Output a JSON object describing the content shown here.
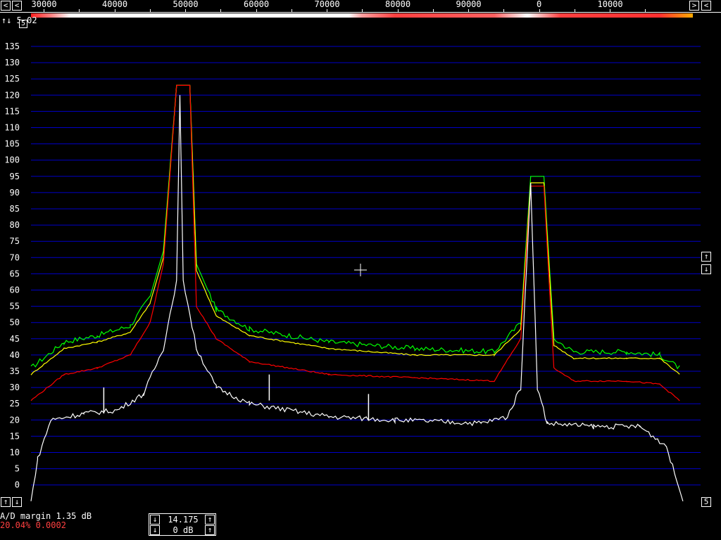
{
  "header": {
    "freq_labels": [
      "30000",
      "40000",
      "50000",
      "60000",
      "70000",
      "80000",
      "90000",
      "0",
      "10000"
    ],
    "left_arrow": "<",
    "right_arrow": ">",
    "overlay_text": "↑↓ 5.02",
    "corner_btn": "5"
  },
  "left_buttons": {
    "up": "↑",
    "down": "↓"
  },
  "right_buttons": {
    "up": "↑",
    "down": "↓",
    "corner": "5"
  },
  "status": {
    "ad_margin": "A/D margin  1.35 dB",
    "rate": "20.04% 0.0002"
  },
  "freq_box": {
    "freq": "14.175",
    "gain": "0 dB",
    "down": "↓",
    "up": "↑"
  },
  "chart_data": {
    "type": "line",
    "y_tick_labels": [
      "135",
      "130",
      "125",
      "120",
      "115",
      "110",
      "105",
      "100",
      "95",
      "90",
      "85",
      "80",
      "75",
      "70",
      "65",
      "60",
      "55",
      "50",
      "45",
      "40",
      "35",
      "30",
      "25",
      "20",
      "15",
      "10",
      "5",
      "0"
    ],
    "ylim": [
      -5,
      135
    ],
    "x_labels": [
      "30000",
      "40000",
      "50000",
      "60000",
      "70000",
      "80000",
      "90000",
      "0",
      "10000"
    ],
    "series": [
      {
        "color": "#00ff00",
        "points": [
          [
            0,
            36
          ],
          [
            0.05,
            44
          ],
          [
            0.1,
            46
          ],
          [
            0.15,
            49
          ],
          [
            0.18,
            58
          ],
          [
            0.2,
            72
          ],
          [
            0.22,
            123
          ],
          [
            0.24,
            123
          ],
          [
            0.25,
            68
          ],
          [
            0.28,
            54
          ],
          [
            0.33,
            48
          ],
          [
            0.45,
            44
          ],
          [
            0.58,
            42
          ],
          [
            0.7,
            41
          ],
          [
            0.74,
            50
          ],
          [
            0.755,
            95
          ],
          [
            0.775,
            95
          ],
          [
            0.79,
            45
          ],
          [
            0.82,
            41
          ],
          [
            0.9,
            41
          ],
          [
            0.95,
            40
          ],
          [
            0.98,
            36
          ]
        ]
      },
      {
        "color": "#ffff00",
        "points": [
          [
            0,
            34
          ],
          [
            0.05,
            42
          ],
          [
            0.1,
            44
          ],
          [
            0.15,
            47
          ],
          [
            0.18,
            56
          ],
          [
            0.2,
            70
          ],
          [
            0.22,
            123
          ],
          [
            0.24,
            123
          ],
          [
            0.25,
            66
          ],
          [
            0.28,
            52
          ],
          [
            0.33,
            46
          ],
          [
            0.45,
            42
          ],
          [
            0.58,
            40
          ],
          [
            0.7,
            40
          ],
          [
            0.74,
            48
          ],
          [
            0.755,
            93
          ],
          [
            0.775,
            93
          ],
          [
            0.79,
            43
          ],
          [
            0.82,
            39
          ],
          [
            0.9,
            39
          ],
          [
            0.95,
            39
          ],
          [
            0.98,
            34
          ]
        ]
      },
      {
        "color": "#ff0000",
        "points": [
          [
            0,
            26
          ],
          [
            0.05,
            34
          ],
          [
            0.1,
            36
          ],
          [
            0.15,
            40
          ],
          [
            0.18,
            50
          ],
          [
            0.2,
            68
          ],
          [
            0.22,
            123
          ],
          [
            0.24,
            123
          ],
          [
            0.25,
            55
          ],
          [
            0.28,
            45
          ],
          [
            0.33,
            38
          ],
          [
            0.45,
            34
          ],
          [
            0.58,
            33
          ],
          [
            0.7,
            32
          ],
          [
            0.74,
            45
          ],
          [
            0.755,
            92
          ],
          [
            0.775,
            92
          ],
          [
            0.79,
            36
          ],
          [
            0.82,
            32
          ],
          [
            0.9,
            32
          ],
          [
            0.95,
            31
          ],
          [
            0.98,
            26
          ]
        ]
      },
      {
        "color": "#ffffff",
        "points": [
          [
            0,
            -5
          ],
          [
            0.01,
            8
          ],
          [
            0.03,
            20
          ],
          [
            0.08,
            22
          ],
          [
            0.13,
            23
          ],
          [
            0.17,
            28
          ],
          [
            0.2,
            42
          ],
          [
            0.22,
            63
          ],
          [
            0.225,
            120
          ],
          [
            0.23,
            63
          ],
          [
            0.25,
            42
          ],
          [
            0.28,
            30
          ],
          [
            0.33,
            25
          ],
          [
            0.45,
            21
          ],
          [
            0.55,
            20
          ],
          [
            0.68,
            19
          ],
          [
            0.72,
            21
          ],
          [
            0.74,
            30
          ],
          [
            0.755,
            93
          ],
          [
            0.765,
            30
          ],
          [
            0.78,
            19
          ],
          [
            0.85,
            18
          ],
          [
            0.92,
            18
          ],
          [
            0.96,
            12
          ],
          [
            0.985,
            -5
          ]
        ]
      }
    ],
    "spikes": [
      [
        0.11,
        30
      ],
      [
        0.36,
        34
      ],
      [
        0.51,
        28
      ]
    ]
  }
}
